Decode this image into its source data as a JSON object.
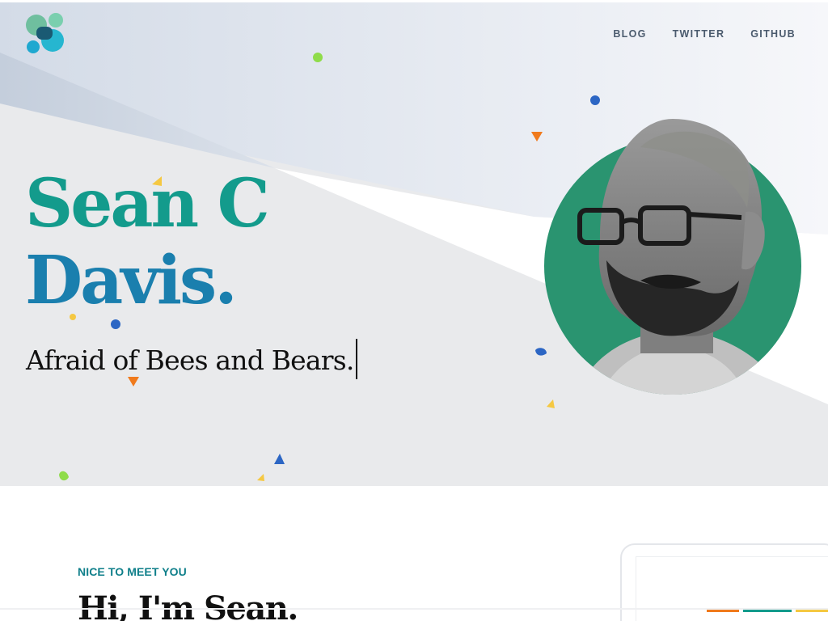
{
  "header": {
    "logo_name": "site-logo",
    "nav": [
      {
        "label": "BLOG"
      },
      {
        "label": "TWITTER"
      },
      {
        "label": "GITHUB"
      }
    ]
  },
  "hero": {
    "title_line1": "Sean C",
    "title_line2": "Davis",
    "title_dot": ".",
    "tagline": "Afraid of Bees and Bears.",
    "avatar_alt": "portrait-photo",
    "colors": {
      "teal": "#139b8c",
      "blue": "#1a7fae",
      "avatar_bg": "#2a9470"
    }
  },
  "about": {
    "eyebrow": "NICE TO MEET YOU",
    "heading": "Hi, I'm Sean."
  }
}
